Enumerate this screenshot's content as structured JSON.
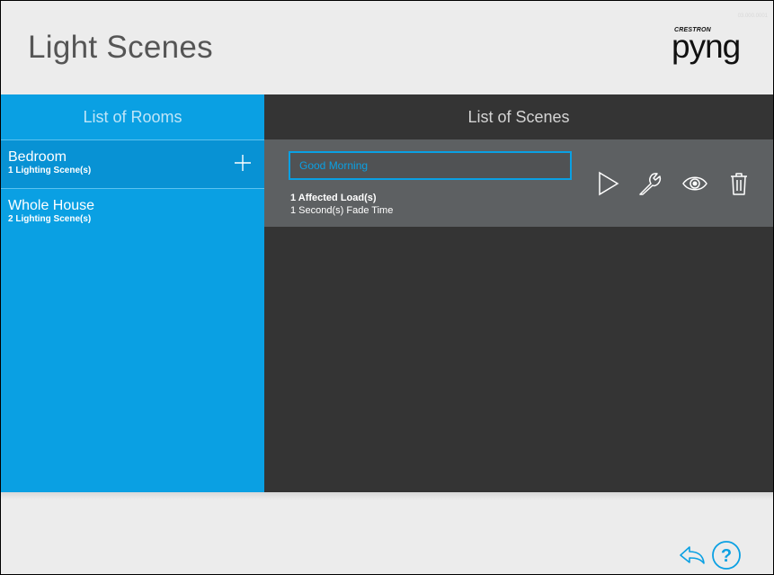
{
  "header": {
    "title": "Light Scenes",
    "brand_small": "CRESTRON",
    "brand_logo": "pyng",
    "version": "03.000.0001"
  },
  "rooms": {
    "heading": "List of Rooms",
    "items": [
      {
        "name": "Bedroom",
        "subtitle": "1 Lighting Scene(s)",
        "selected": true
      },
      {
        "name": "Whole House",
        "subtitle": "2 Lighting Scene(s)",
        "selected": false
      }
    ],
    "add_icon": "plus-icon"
  },
  "scenes": {
    "heading": "List of Scenes",
    "items": [
      {
        "name_value": "Good Morning",
        "affected_loads": "1 Affected Load(s)",
        "fade_time": "1 Second(s) Fade Time",
        "actions": [
          "play-icon",
          "wrench-icon",
          "eye-icon",
          "trash-icon"
        ]
      }
    ]
  },
  "footer": {
    "icons": [
      "back-arrow-icon",
      "help-icon"
    ]
  },
  "colors": {
    "accent_blue": "#0aa0e3",
    "selected_blue": "#0892d4",
    "dark_panel": "#343434",
    "scene_card": "#5d6062",
    "page_bg": "#ececec"
  }
}
